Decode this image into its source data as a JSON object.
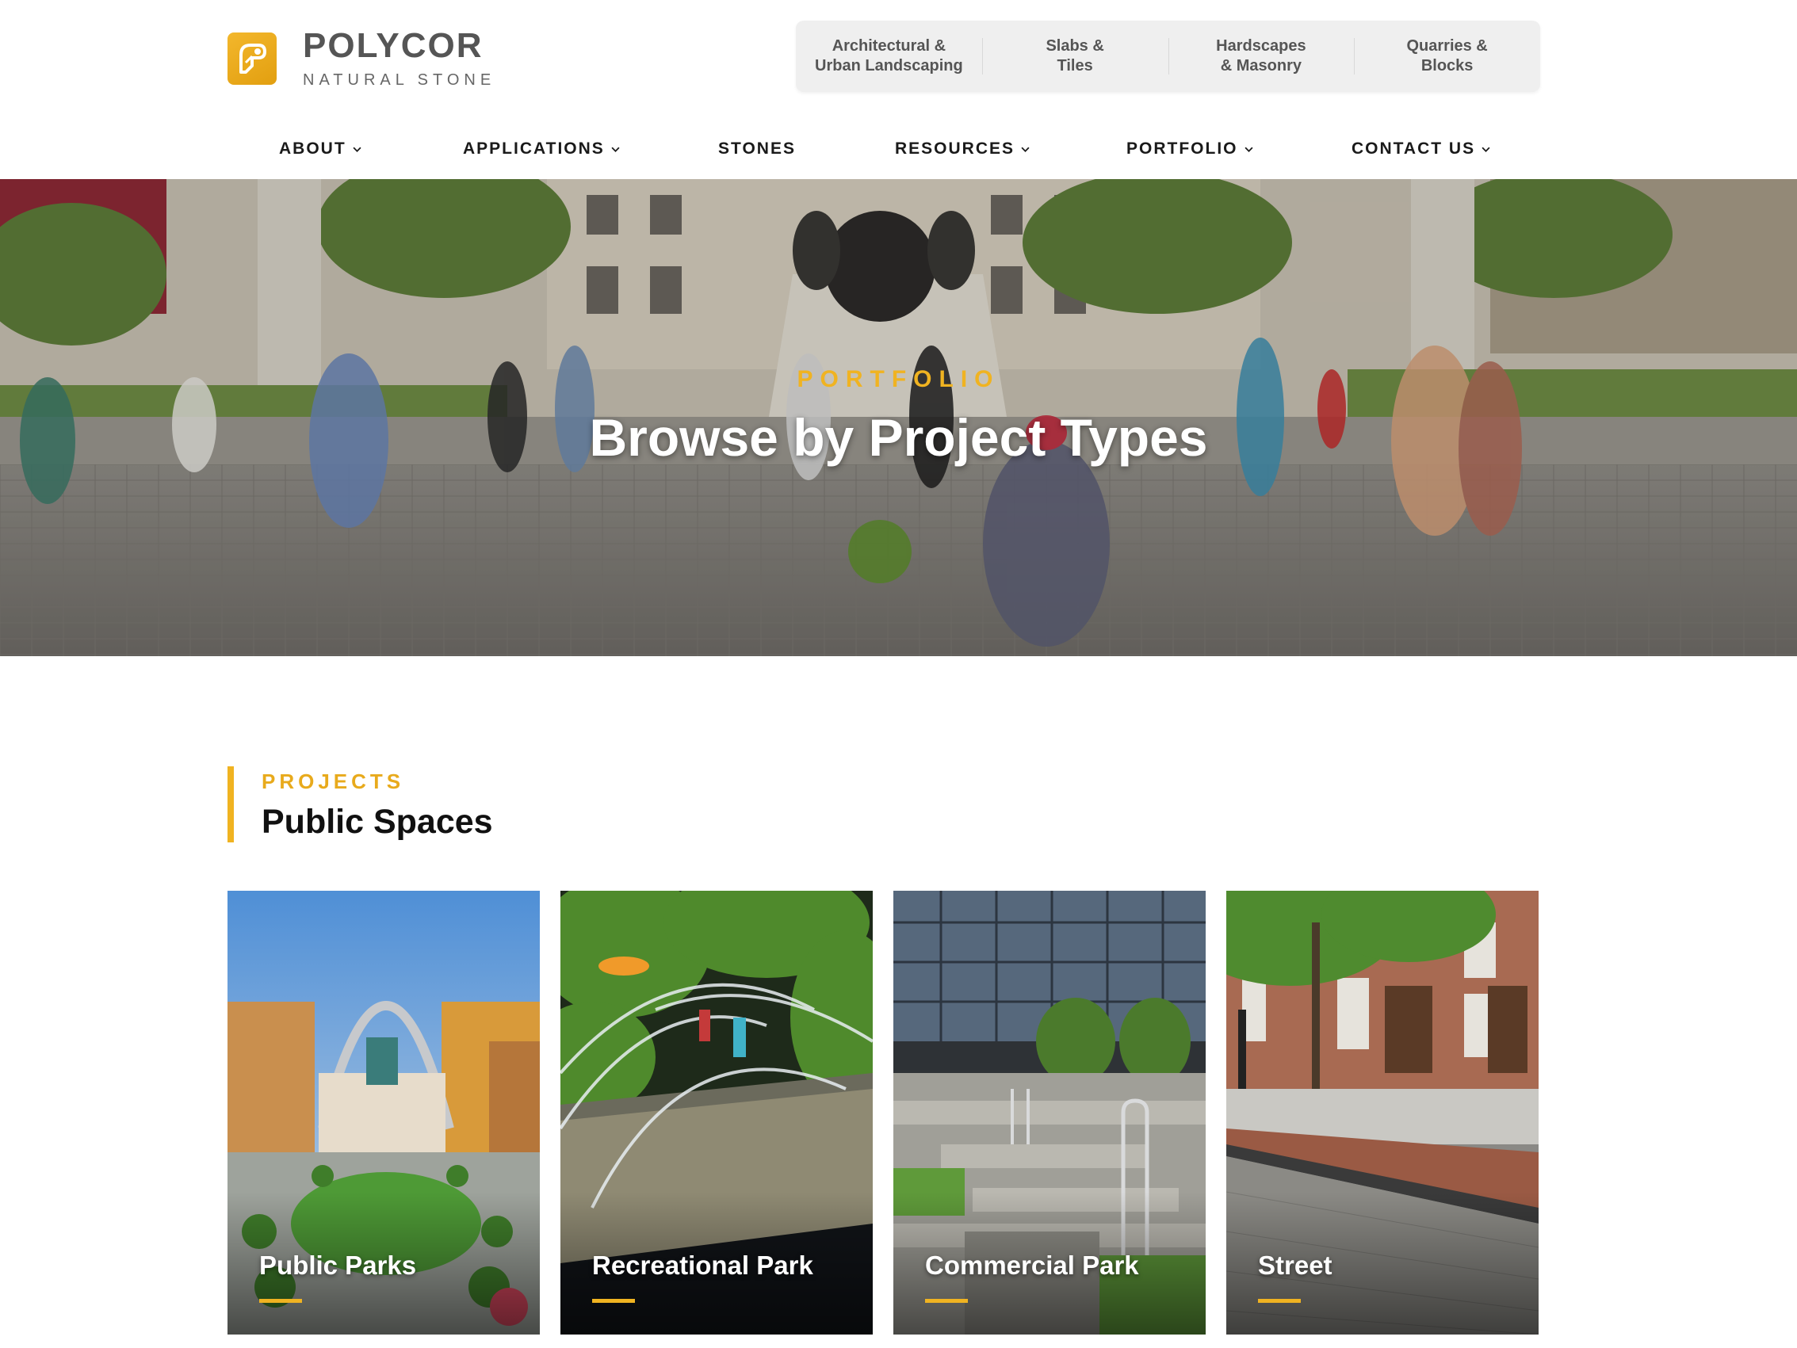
{
  "brand": {
    "name": "POLYCOR",
    "tagline": "NATURAL STONE",
    "accent_color": "#f0b321"
  },
  "top_nav": [
    {
      "line1": "Architectural &",
      "line2": "Urban Landscaping"
    },
    {
      "line1": "Slabs &",
      "line2": "Tiles"
    },
    {
      "line1": "Hardscapes",
      "line2": "& Masonry"
    },
    {
      "line1": "Quarries &",
      "line2": "Blocks"
    }
  ],
  "main_nav": [
    {
      "label": "ABOUT",
      "has_dropdown": true
    },
    {
      "label": "APPLICATIONS",
      "has_dropdown": true
    },
    {
      "label": "STONES",
      "has_dropdown": false
    },
    {
      "label": "RESOURCES",
      "has_dropdown": true
    },
    {
      "label": "PORTFOLIO",
      "has_dropdown": true
    },
    {
      "label": "CONTACT US",
      "has_dropdown": true
    }
  ],
  "hero": {
    "eyebrow": "PORTFOLIO",
    "title": "Browse by Project Types"
  },
  "section": {
    "eyebrow": "PROJECTS",
    "title": "Public Spaces"
  },
  "cards": [
    {
      "label": "Public Parks"
    },
    {
      "label": "Recreational Park"
    },
    {
      "label": "Commercial Park"
    },
    {
      "label": "Street"
    }
  ],
  "icons": {
    "logo": "polycor-logo-icon",
    "dropdown": "chevron-down-icon"
  }
}
